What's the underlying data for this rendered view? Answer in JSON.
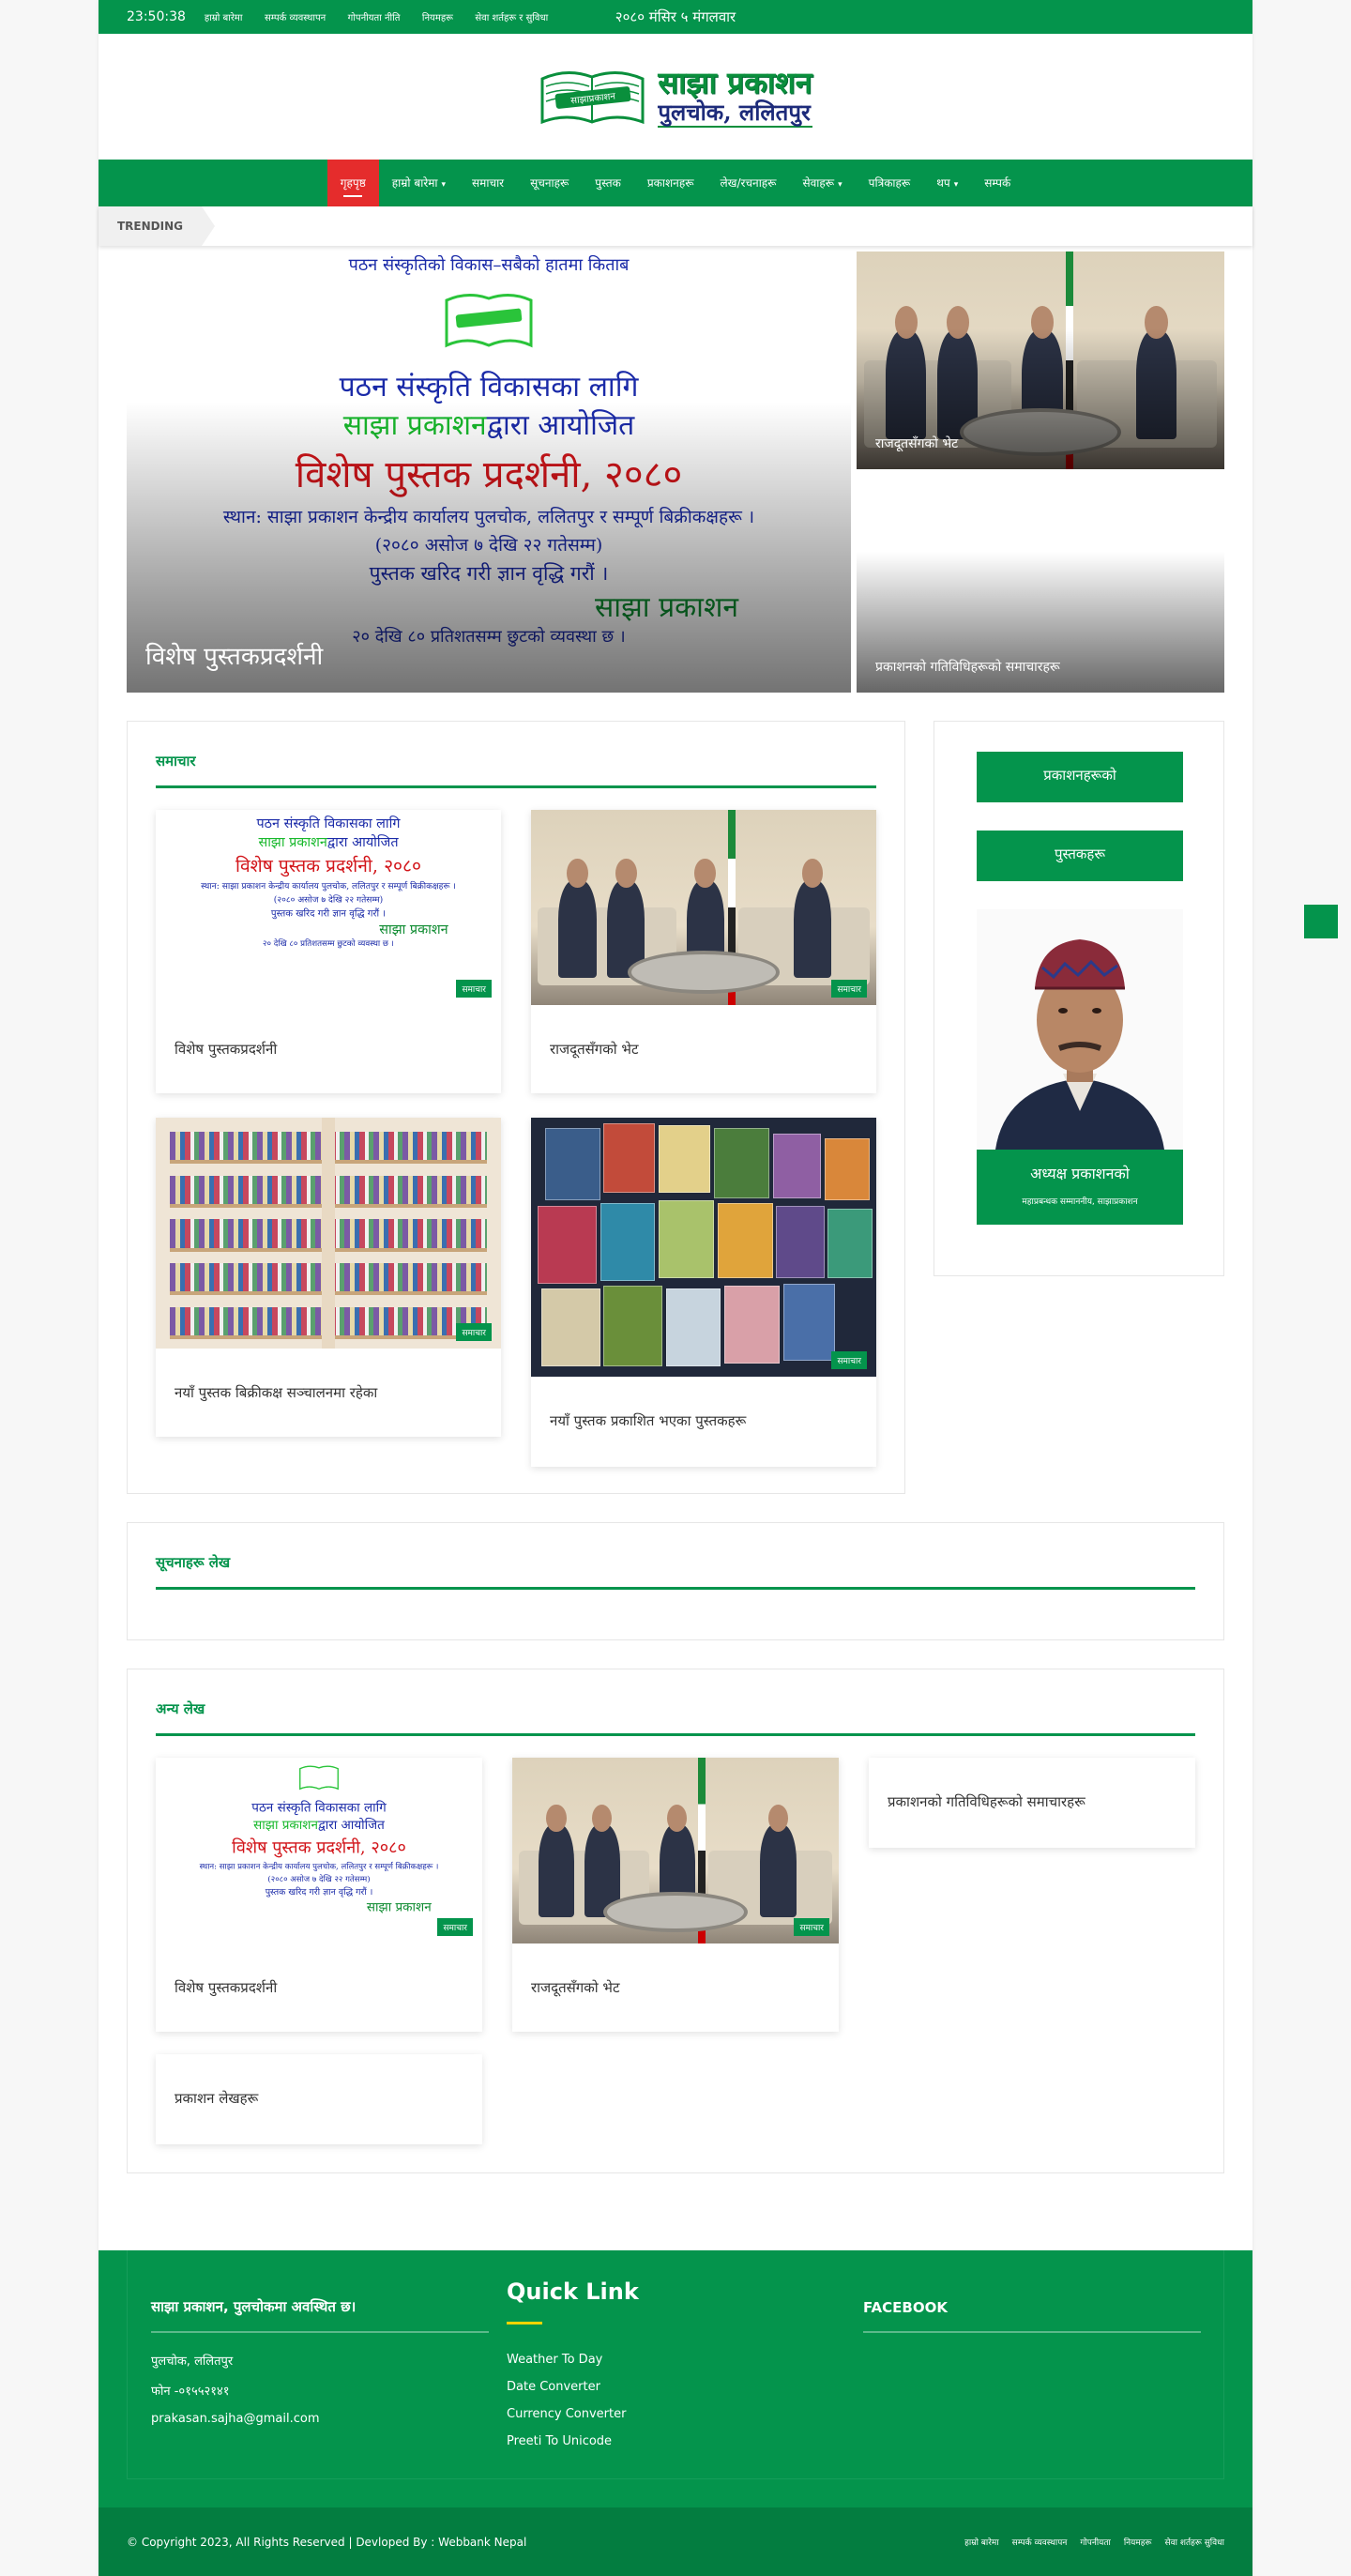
{
  "topbar": {
    "time": " 23:50:38",
    "date": "२०८० मंसिर ५ मंगलवार",
    "links": [
      "हाम्रो बारेमा",
      "सम्पर्क व्यवस्थापन",
      "गोपनीयता नीति",
      "नियमहरू",
      "सेवा शर्तहरू र सुविधा"
    ],
    "tools": [
      "",
      ""
    ]
  },
  "logo": {
    "line1": "साझा प्रकाशन",
    "line2": "पुलचोक, ललितपुर",
    "book_text": "साझाप्रकाशन"
  },
  "nav": {
    "items": [
      {
        "label": "गृहपृष्ठ",
        "active": true
      },
      {
        "label": "हाम्रो बारेमा",
        "caret": "▾"
      },
      {
        "label": "समाचार"
      },
      {
        "label": "सूचनाहरू"
      },
      {
        "label": "पुस्तक"
      },
      {
        "label": "प्रकाशनहरू"
      },
      {
        "label": "लेख/रचनाहरू"
      },
      {
        "label": "सेवाहरू",
        "caret": "▾"
      },
      {
        "label": "पत्रिकाहरू"
      },
      {
        "label": "थप",
        "caret": "▾"
      },
      {
        "label": "सम्पर्क"
      }
    ]
  },
  "trending": {
    "label": "TRENDING"
  },
  "hero": {
    "main_caption": "विशेष पुस्तकप्रदर्शनी",
    "side1_caption": "राजदूतसँगको भेट",
    "side2_caption": "प्रकाशनको गतिविधिहरूको समाचारहरू",
    "poster": {
      "line1": "पठन संस्कृतिको विकास–सबैको हातमा किताब",
      "line2": "पठन संस्कृति विकासका लागि",
      "line3a": "साझा प्रकाशन",
      "line3b": "द्वारा आयोजित",
      "line4": "विशेष पुस्तक प्रदर्शनी, २०८०",
      "line5": "स्थान: साझा प्रकाशन केन्द्रीय कार्यालय पुलचोक, ललितपुर र सम्पूर्ण बिक्रीकक्षहरू ।",
      "line6": "(२०८० असोज ७ देखि २२ गतेसम्म)",
      "line7": "पुस्तक खरिद गरी ज्ञान वृद्धि गरौं ।",
      "line8": "साझा प्रकाशन",
      "line9": "२० देखि ८० प्रतिशतसम्म छुटको व्यवस्था छ ।"
    }
  },
  "news_section": {
    "heading": "समाचार",
    "cards": [
      {
        "title": "विशेष पुस्तकप्रदर्शनी",
        "badge": "समाचार"
      },
      {
        "title": "राजदूतसँगको भेट",
        "badge": "समाचार"
      },
      {
        "title": "नयाँ पुस्तक बिक्रीकक्ष सञ्चालनमा रहेका",
        "badge": "समाचार"
      },
      {
        "title": "नयाँ पुस्तक प्रकाशित भएका पुस्तकहरू",
        "badge": "समाचार"
      }
    ]
  },
  "sidebar": {
    "button1": "प्रकाशनहरूको",
    "button2": "पुस्तकहरू",
    "profile_name": "अध्यक्ष प्रकाशनको",
    "profile_role": "महाप्रबन्धक सम्माननीय, साझाप्रकाशन"
  },
  "notice_section": {
    "heading": "सूचनाहरू लेख"
  },
  "other_section": {
    "heading": "अन्य लेख",
    "cards": [
      {
        "title": "विशेष पुस्तकप्रदर्शनी",
        "badge": "समाचार"
      },
      {
        "title": "राजदूतसँगको भेट",
        "badge": "समाचार"
      },
      {
        "title": "प्रकाशनको गतिविधिहरूको समाचारहरू"
      },
      {
        "title": "प्रकाशन लेखहरू"
      }
    ]
  },
  "footer": {
    "about_heading": "साझा प्रकाशन, पुलचोकमा अवस्थित छ।",
    "address": " पुलचोक, ललितपुर",
    "phone": " फोन -०१५५२१४१",
    "email": " prakasan.sajha@gmail.com",
    "quick_heading": "Quick Link",
    "quick_links": [
      "Weather To Day",
      "Date Converter",
      "Currency Converter",
      "Preeti To Unicode"
    ],
    "fb_heading": "FACEBOOK"
  },
  "copyright": {
    "text": "© Copyright 2023, All Rights Reserved  |  Devloped By :  Webbank Nepal",
    "links": [
      "हाम्रो बारेमा",
      "सम्पर्क व्यवस्थापन",
      "गोपनीयता",
      "नियमहरू",
      "सेवा शर्तहरू सुविधा"
    ]
  },
  "float_icon": "",
  "colors": {
    "primary": "#04944c",
    "active": "#e52c2c",
    "poster_blue": "#1a2aa8",
    "poster_red": "#d2151a"
  }
}
